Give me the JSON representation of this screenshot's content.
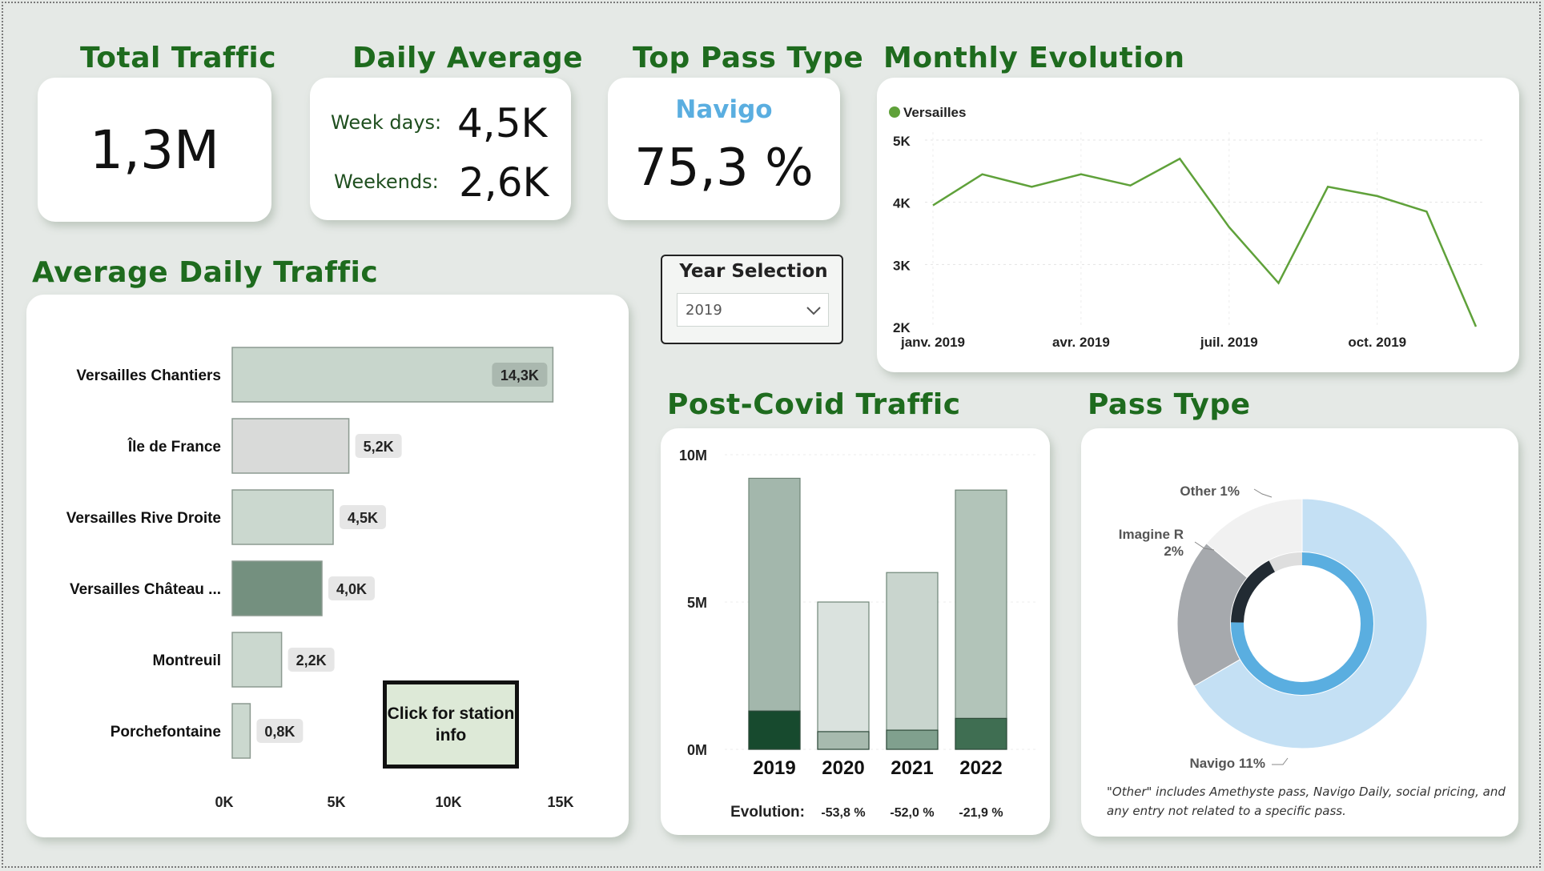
{
  "kpis": {
    "total_traffic": {
      "title": "Total Traffic",
      "value": "1,3M"
    },
    "daily_average": {
      "title": "Daily Average",
      "weekdays_label": "Week days:",
      "weekdays_value": "4,5K",
      "weekends_label": "Weekends:",
      "weekends_value": "2,6K"
    },
    "top_pass": {
      "title": "Top Pass Type",
      "name": "Navigo",
      "value": "75,3 %"
    }
  },
  "year_selection": {
    "title": "Year Selection",
    "selected": "2019"
  },
  "station_button": {
    "label": "Click for station info"
  },
  "colors": {
    "title_green": "#1e6b1e",
    "line_green": "#5fa13a",
    "navigo_blue": "#5aaee0",
    "dark_green": "#174a2e"
  },
  "charts": {
    "avg_daily": {
      "title": "Average Daily Traffic",
      "chart_data": {
        "type": "bar",
        "orientation": "horizontal",
        "categories": [
          "Versailles Chantiers",
          "Île de France",
          "Versailles Rive Droite",
          "Versailles Château ...",
          "Montreuil",
          "Porchefontaine"
        ],
        "values": [
          14.3,
          5.2,
          4.5,
          4.0,
          2.2,
          0.8
        ],
        "labels": [
          "14,3K",
          "5,2K",
          "4,5K",
          "4,0K",
          "2,2K",
          "0,8K"
        ],
        "bar_colors": [
          "#c8d6cc",
          "#d9dad9",
          "#cbd8cf",
          "#74907f",
          "#cbd8cf",
          "#cbd8cf"
        ],
        "xticks": [
          "0K",
          "5K",
          "10K",
          "15K"
        ],
        "xlim": [
          0,
          15
        ]
      }
    },
    "monthly": {
      "title": "Monthly Evolution",
      "chart_data": {
        "type": "line",
        "series": [
          {
            "name": "Versailles",
            "values": [
              3.95,
              4.45,
              4.25,
              4.45,
              4.27,
              4.7,
              3.6,
              2.7,
              4.25,
              4.1,
              3.85,
              2.0
            ]
          }
        ],
        "yticks": [
          "5K",
          "4K",
          "3K",
          "2K"
        ],
        "ylim": [
          2,
          5
        ],
        "xticks": [
          "janv. 2019",
          "avr. 2019",
          "juil. 2019",
          "oct. 2019"
        ]
      }
    },
    "post_covid": {
      "title": "Post-Covid Traffic",
      "chart_data": {
        "type": "bar",
        "categories": [
          "2019",
          "2020",
          "2021",
          "2022"
        ],
        "series": [
          {
            "values": [
              9.2,
              5.0,
              6.0,
              8.8
            ]
          },
          {
            "values": [
              1.3,
              0.6,
              0.65,
              1.05
            ]
          }
        ],
        "total_colors": [
          "#a3b7ac",
          "#dae2de",
          "#c9d5ce",
          "#b2c4b9"
        ],
        "inner_colors": [
          "#174a2e",
          "#a7baae",
          "#80a08e",
          "#3f6e52"
        ],
        "yticks": [
          "10M",
          "5M",
          "0M"
        ],
        "ylim": [
          0,
          10
        ],
        "evolution_label": "Evolution:",
        "evolution": [
          "-53,8 %",
          "-52,0 %",
          "-21,9 %"
        ]
      }
    },
    "pass_type": {
      "title": "Pass Type",
      "chart_data": {
        "type": "pie",
        "outer_ring": [
          {
            "label": "Navigo 11%",
            "value": 11,
            "color": "#c4e0f4"
          },
          {
            "label": "Imagine R 2%",
            "value": 2,
            "color": "#a6a9ad"
          },
          {
            "label": "Other 1%",
            "value": 1,
            "color": "#f1f1f1"
          }
        ],
        "outer_angles": [
          [
            0,
            240
          ],
          [
            240,
            310
          ],
          [
            310,
            360
          ]
        ],
        "inner_ring": [
          {
            "value": 75.3,
            "color": "#5aaee0"
          },
          {
            "value": 17,
            "color": "#222b33"
          },
          {
            "value": 7.7,
            "color": "#dedede"
          }
        ],
        "footnote": "\"Other\" includes Amethyste pass, Navigo Daily, social pricing, and any entry not related to a specific pass."
      }
    }
  }
}
